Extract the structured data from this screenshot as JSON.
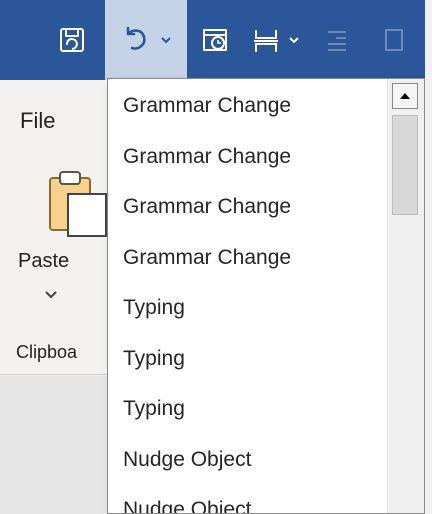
{
  "toolbar": {
    "icons": [
      "autosave-icon",
      "undo-icon",
      "chevron-down-icon",
      "new-appointment-icon",
      "page-break-icon",
      "chevron-down-icon",
      "indent-icon",
      "copy-icon"
    ],
    "accent": "#2b579a",
    "undo_highlight": "#c5d3e8"
  },
  "ribbon": {
    "file_tab": "File",
    "paste_label": "Paste",
    "clipboard_label": "Clipboa"
  },
  "undo_menu": {
    "items": [
      "Grammar Change",
      "Grammar Change",
      "Grammar Change",
      "Grammar Change",
      "Typing",
      "Typing",
      "Typing",
      "Nudge Object",
      "Nudge Object"
    ]
  }
}
